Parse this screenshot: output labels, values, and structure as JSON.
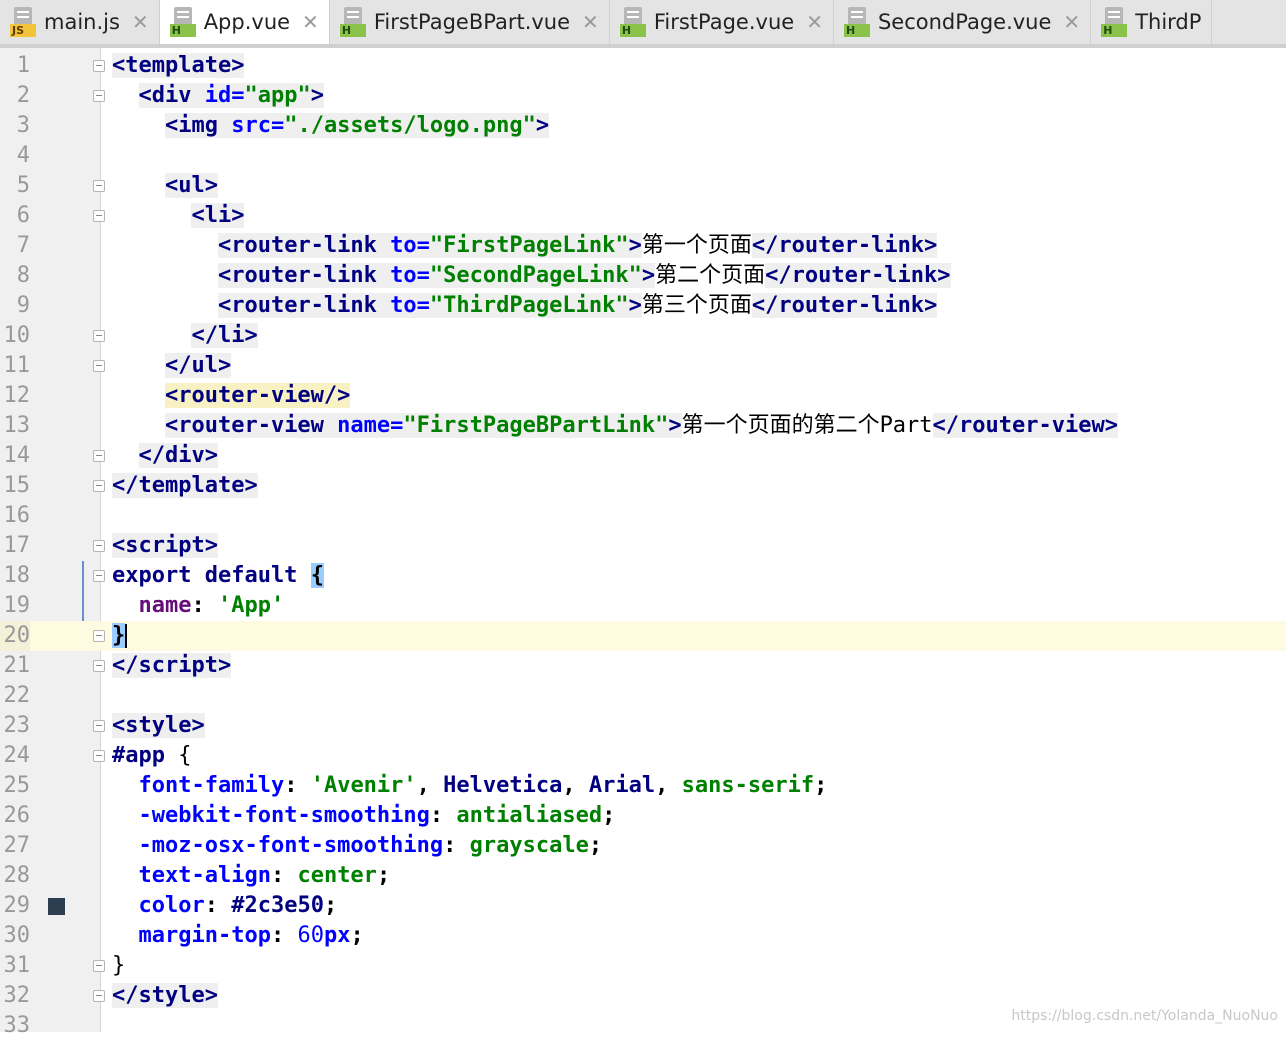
{
  "tabs": [
    {
      "label": "main.js",
      "badge": "JS",
      "type": "js",
      "active": false
    },
    {
      "label": "App.vue",
      "badge": "H",
      "type": "html",
      "active": true
    },
    {
      "label": "FirstPageBPart.vue",
      "badge": "H",
      "type": "html",
      "active": false
    },
    {
      "label": "FirstPage.vue",
      "badge": "H",
      "type": "html",
      "active": false
    },
    {
      "label": "SecondPage.vue",
      "badge": "H",
      "type": "html",
      "active": false
    },
    {
      "label": "ThirdP",
      "badge": "H",
      "type": "html",
      "active": false
    }
  ],
  "close_glyph": "✕",
  "current_line": 20,
  "lines": [
    {
      "n": "1",
      "fold": true,
      "html": "<span class='tag'>&lt;template&gt;</span>"
    },
    {
      "n": "2",
      "fold": true,
      "html": "  <span class='tag'>&lt;div <span class='attr'>id=</span><span class='val'>\"app\"</span>&gt;</span>"
    },
    {
      "n": "3",
      "html": "    <span class='tag'>&lt;img <span class='attr'>src=</span><span class='val'>\"./assets/logo.png\"</span>&gt;</span>"
    },
    {
      "n": "4",
      "html": ""
    },
    {
      "n": "5",
      "fold": true,
      "html": "    <span class='tag'>&lt;ul&gt;</span>"
    },
    {
      "n": "6",
      "fold": true,
      "html": "      <span class='tag'>&lt;li&gt;</span>"
    },
    {
      "n": "7",
      "html": "        <span class='tag'>&lt;router-link <span class='attr'>to=</span><span class='val'>\"FirstPageLink\"</span>&gt;</span><span class='plain'>第一个页面</span><span class='tag'>&lt;/<span class='rl'>router-link</span>&gt;</span>"
    },
    {
      "n": "8",
      "html": "        <span class='tag'>&lt;router-link <span class='attr'>to=</span><span class='val'>\"SecondPageLink\"</span>&gt;</span><span class='plain'>第二个页面</span><span class='tag'>&lt;/<span class='rl'>router-link</span>&gt;</span>"
    },
    {
      "n": "9",
      "html": "        <span class='tag'>&lt;router-link <span class='attr'>to=</span><span class='val'>\"ThirdPageLink\"</span>&gt;</span><span class='plain'>第三个页面</span><span class='tag'>&lt;/<span class='rl'>router-link</span>&gt;</span>"
    },
    {
      "n": "10",
      "fold": true,
      "html": "      <span class='tag'>&lt;/li&gt;</span>"
    },
    {
      "n": "11",
      "fold": true,
      "html": "    <span class='tag'>&lt;/ul&gt;</span>"
    },
    {
      "n": "12",
      "html": "    <span class='tag rl'>&lt;router-view/&gt;</span>"
    },
    {
      "n": "13",
      "html": "    <span class='tag'>&lt;router-view <span class='attr'>name=</span><span class='val'>\"FirstPageBPartLink\"</span>&gt;</span><span class='plain'>第一个页面的第二个Part</span><span class='tag'>&lt;/<span class='rl'>router-view</span>&gt;</span>"
    },
    {
      "n": "14",
      "fold": true,
      "html": "  <span class='tag'>&lt;/div&gt;</span>"
    },
    {
      "n": "15",
      "fold": true,
      "html": "<span class='tag'>&lt;/template&gt;</span>"
    },
    {
      "n": "16",
      "html": ""
    },
    {
      "n": "17",
      "fold": true,
      "html": "<span class='tag'>&lt;script&gt;</span>"
    },
    {
      "n": "18",
      "fold": true,
      "html": "<span class='kw'>export default</span> <span class='brace'>{</span>"
    },
    {
      "n": "19",
      "html": "  <span class='prop'>name</span>: <span class='val'>'App'</span>"
    },
    {
      "n": "20",
      "fold": true,
      "html": "<span class='brace'>}</span><span class='caret'></span>"
    },
    {
      "n": "21",
      "fold": true,
      "html": "<span class='tag'>&lt;/script&gt;</span>"
    },
    {
      "n": "22",
      "html": ""
    },
    {
      "n": "23",
      "fold": true,
      "html": "<span class='tag'>&lt;style&gt;</span>"
    },
    {
      "n": "24",
      "fold": true,
      "html": "<span class='kw'>#app</span> <span class='plain'>{</span>"
    },
    {
      "n": "25",
      "html": "  <span class='css-prop'>font-family</span>: <span class='val'>'Avenir'</span>, <span class='kw'>Helvetica</span>, <span class='kw'>Arial</span>, <span class='val'>sans-serif</span>;"
    },
    {
      "n": "26",
      "html": "  <span class='css-prop'>-webkit-font-smoothing</span>: <span class='val'>antialiased</span>;"
    },
    {
      "n": "27",
      "html": "  <span class='css-prop'>-moz-osx-font-smoothing</span>: <span class='val'>grayscale</span>;"
    },
    {
      "n": "28",
      "html": "  <span class='css-prop'>text-align</span>: <span class='val'>center</span>;"
    },
    {
      "n": "29",
      "swatch": true,
      "html": "  <span class='css-prop'>color</span>: <span class='kw'>#2c3e50</span>;"
    },
    {
      "n": "30",
      "html": "  <span class='css-prop'>margin-top</span>: <span class='num'>60</span><span class='css-prop'>px</span>;"
    },
    {
      "n": "31",
      "fold": true,
      "html": "<span class='plain'>}</span>"
    },
    {
      "n": "32",
      "fold": true,
      "html": "<span class='tag'>&lt;/style&gt;</span>"
    },
    {
      "n": "33",
      "html": ""
    }
  ],
  "colors": {
    "swatch": "#2c3e50",
    "tag_bg": "#efefef",
    "router_tag_bg": "#f7f1c4",
    "current_line_bg": "#fffbe0"
  },
  "watermark": "https://blog.csdn.net/Yolanda_NuoNuo"
}
